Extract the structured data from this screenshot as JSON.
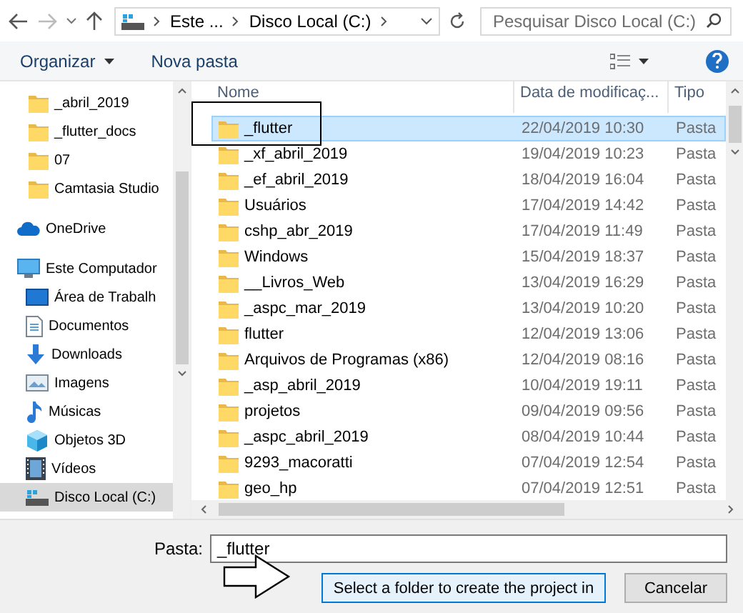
{
  "nav": {
    "crumbs": [
      "Este ...",
      "Disco Local (C:)"
    ],
    "search": {
      "placeholder": "Pesquisar Disco Local (C:)"
    }
  },
  "toolbar": {
    "organize": "Organizar",
    "new_folder": "Nova pasta"
  },
  "sidebar": {
    "items": [
      {
        "kind": "folder",
        "label": "_abril_2019",
        "selected": false
      },
      {
        "kind": "folder",
        "label": "_flutter_docs",
        "selected": false
      },
      {
        "kind": "folder",
        "label": "07",
        "selected": false
      },
      {
        "kind": "folder",
        "label": "Camtasia Studio",
        "selected": false
      },
      {
        "kind": "onedrive",
        "label": "OneDrive",
        "selected": false
      },
      {
        "kind": "computer",
        "label": "Este Computador",
        "selected": false,
        "children": [
          {
            "kind": "desktop",
            "label": "Área de Trabalh",
            "selected": false
          },
          {
            "kind": "documents",
            "label": "Documentos",
            "selected": false
          },
          {
            "kind": "downloads",
            "label": "Downloads",
            "selected": false
          },
          {
            "kind": "images",
            "label": "Imagens",
            "selected": false
          },
          {
            "kind": "music",
            "label": "Músicas",
            "selected": false
          },
          {
            "kind": "objects3d",
            "label": "Objetos 3D",
            "selected": false
          },
          {
            "kind": "videos",
            "label": "Vídeos",
            "selected": false
          },
          {
            "kind": "drive",
            "label": "Disco Local (C:)",
            "selected": true
          }
        ]
      }
    ]
  },
  "table": {
    "columns": [
      "Nome",
      "Data de modificaç...",
      "Tipo"
    ],
    "rows": [
      {
        "name": "_flutter",
        "date": "22/04/2019 10:30",
        "type": "Pasta",
        "selected": true
      },
      {
        "name": "_xf_abril_2019",
        "date": "19/04/2019 10:23",
        "type": "Pasta",
        "selected": false
      },
      {
        "name": "_ef_abril_2019",
        "date": "18/04/2019 16:04",
        "type": "Pasta",
        "selected": false
      },
      {
        "name": "Usuários",
        "date": "17/04/2019 14:42",
        "type": "Pasta",
        "selected": false
      },
      {
        "name": "cshp_abr_2019",
        "date": "17/04/2019 11:49",
        "type": "Pasta",
        "selected": false
      },
      {
        "name": "Windows",
        "date": "15/04/2019 18:37",
        "type": "Pasta",
        "selected": false
      },
      {
        "name": "__Livros_Web",
        "date": "13/04/2019 16:29",
        "type": "Pasta",
        "selected": false
      },
      {
        "name": "_aspc_mar_2019",
        "date": "13/04/2019 10:20",
        "type": "Pasta",
        "selected": false
      },
      {
        "name": "flutter",
        "date": "12/04/2019 13:06",
        "type": "Pasta",
        "selected": false
      },
      {
        "name": "Arquivos de Programas (x86)",
        "date": "12/04/2019 08:16",
        "type": "Pasta",
        "selected": false
      },
      {
        "name": "_asp_abril_2019",
        "date": "10/04/2019 19:11",
        "type": "Pasta",
        "selected": false
      },
      {
        "name": "projetos",
        "date": "09/04/2019 09:56",
        "type": "Pasta",
        "selected": false
      },
      {
        "name": "_aspc_abril_2019",
        "date": "08/04/2019 10:44",
        "type": "Pasta",
        "selected": false
      },
      {
        "name": "9293_macoratti",
        "date": "07/04/2019 12:54",
        "type": "Pasta",
        "selected": false
      },
      {
        "name": "geo_hp",
        "date": "07/04/2019 12:51",
        "type": "Pasta",
        "selected": false
      }
    ]
  },
  "footer": {
    "folder_label": "Pasta:",
    "folder_value": "_flutter",
    "buttons": [
      {
        "label": "Select a folder to create the project in",
        "primary": true
      },
      {
        "label": "Cancelar",
        "primary": false
      }
    ]
  }
}
